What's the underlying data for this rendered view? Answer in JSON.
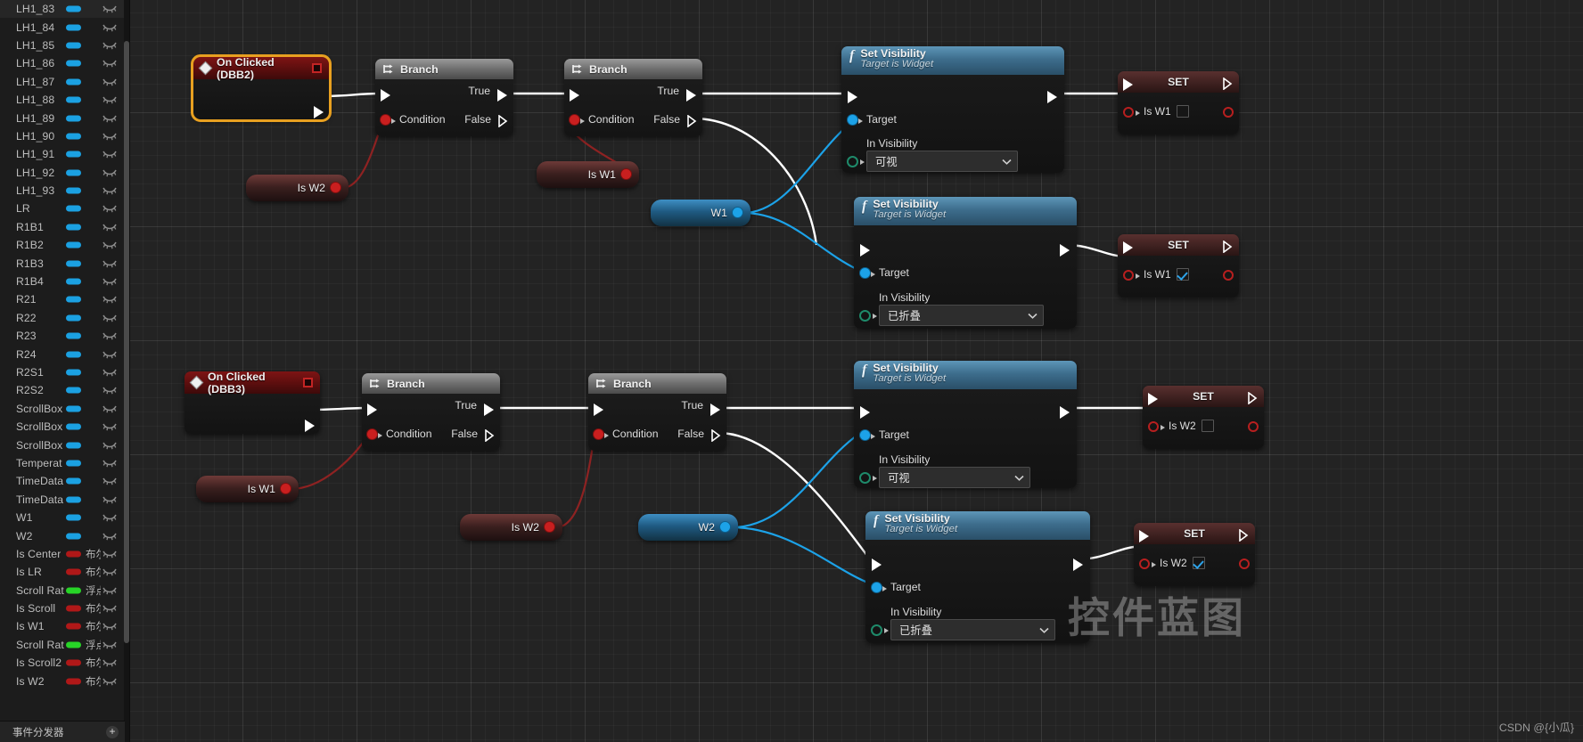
{
  "sidebar": {
    "variables": [
      {
        "name": "LH1_83",
        "pill": "#1ba1e2",
        "type": "",
        "eye": "eye-closed-icon"
      },
      {
        "name": "LH1_84",
        "pill": "#1ba1e2",
        "type": "",
        "eye": "eye-closed-icon"
      },
      {
        "name": "LH1_85",
        "pill": "#1ba1e2",
        "type": "",
        "eye": "eye-closed-icon"
      },
      {
        "name": "LH1_86",
        "pill": "#1ba1e2",
        "type": "",
        "eye": "eye-closed-icon"
      },
      {
        "name": "LH1_87",
        "pill": "#1ba1e2",
        "type": "",
        "eye": "eye-closed-icon"
      },
      {
        "name": "LH1_88",
        "pill": "#1ba1e2",
        "type": "",
        "eye": "eye-closed-icon"
      },
      {
        "name": "LH1_89",
        "pill": "#1ba1e2",
        "type": "",
        "eye": "eye-closed-icon"
      },
      {
        "name": "LH1_90",
        "pill": "#1ba1e2",
        "type": "",
        "eye": "eye-closed-icon"
      },
      {
        "name": "LH1_91",
        "pill": "#1ba1e2",
        "type": "",
        "eye": "eye-closed-icon"
      },
      {
        "name": "LH1_92",
        "pill": "#1ba1e2",
        "type": "",
        "eye": "eye-closed-icon"
      },
      {
        "name": "LH1_93",
        "pill": "#1ba1e2",
        "type": "",
        "eye": "eye-closed-icon"
      },
      {
        "name": "LR",
        "pill": "#1ba1e2",
        "type": "",
        "eye": "eye-closed-icon"
      },
      {
        "name": "R1B1",
        "pill": "#1ba1e2",
        "type": "",
        "eye": "eye-closed-icon"
      },
      {
        "name": "R1B2",
        "pill": "#1ba1e2",
        "type": "",
        "eye": "eye-closed-icon"
      },
      {
        "name": "R1B3",
        "pill": "#1ba1e2",
        "type": "",
        "eye": "eye-closed-icon"
      },
      {
        "name": "R1B4",
        "pill": "#1ba1e2",
        "type": "",
        "eye": "eye-closed-icon"
      },
      {
        "name": "R21",
        "pill": "#1ba1e2",
        "type": "",
        "eye": "eye-closed-icon"
      },
      {
        "name": "R22",
        "pill": "#1ba1e2",
        "type": "",
        "eye": "eye-closed-icon"
      },
      {
        "name": "R23",
        "pill": "#1ba1e2",
        "type": "",
        "eye": "eye-closed-icon"
      },
      {
        "name": "R24",
        "pill": "#1ba1e2",
        "type": "",
        "eye": "eye-closed-icon"
      },
      {
        "name": "R2S1",
        "pill": "#1ba1e2",
        "type": "",
        "eye": "eye-closed-icon"
      },
      {
        "name": "R2S2",
        "pill": "#1ba1e2",
        "type": "",
        "eye": "eye-closed-icon"
      },
      {
        "name": "ScrollBox",
        "pill": "#1ba1e2",
        "type": "",
        "eye": "eye-closed-icon"
      },
      {
        "name": "ScrollBox",
        "pill": "#1ba1e2",
        "type": "",
        "eye": "eye-closed-icon"
      },
      {
        "name": "ScrollBox",
        "pill": "#1ba1e2",
        "type": "",
        "eye": "eye-closed-icon"
      },
      {
        "name": "Temperat",
        "pill": "#1ba1e2",
        "type": "",
        "eye": "eye-closed-icon"
      },
      {
        "name": "TimeData",
        "pill": "#1ba1e2",
        "type": "",
        "eye": "eye-closed-icon"
      },
      {
        "name": "TimeData",
        "pill": "#1ba1e2",
        "type": "",
        "eye": "eye-closed-icon"
      },
      {
        "name": "W1",
        "pill": "#1ba1e2",
        "type": "",
        "eye": "eye-closed-icon"
      },
      {
        "name": "W2",
        "pill": "#1ba1e2",
        "type": "",
        "eye": "eye-closed-icon"
      },
      {
        "name": "Is Center",
        "pill": "#b01818",
        "type": "布尔",
        "eye": "eye-closed-icon"
      },
      {
        "name": "Is LR",
        "pill": "#b01818",
        "type": "布尔",
        "eye": "eye-closed-icon"
      },
      {
        "name": "Scroll Rat",
        "pill": "#27d427",
        "type": "浮点",
        "eye": "eye-closed-icon"
      },
      {
        "name": "Is Scroll",
        "pill": "#b01818",
        "type": "布尔",
        "eye": "eye-closed-icon"
      },
      {
        "name": "Is W1",
        "pill": "#b01818",
        "type": "布尔",
        "eye": "eye-closed-icon"
      },
      {
        "name": "Scroll Rat",
        "pill": "#27d427",
        "type": "浮点",
        "eye": "eye-closed-icon"
      },
      {
        "name": "Is Scroll2",
        "pill": "#b01818",
        "type": "布尔",
        "eye": "eye-closed-icon"
      },
      {
        "name": "Is W2",
        "pill": "#b01818",
        "type": "布尔",
        "eye": "eye-closed-icon"
      }
    ],
    "dispatcher_label": "事件分发器",
    "add_button": "+"
  },
  "graph": {
    "events": [
      {
        "title": "On Clicked (DBB2)",
        "selected": true
      },
      {
        "title": "On Clicked (DBB3)",
        "selected": false
      }
    ],
    "branches": [
      {
        "title": "Branch",
        "true_label": "True",
        "false_label": "False",
        "condition_label": "Condition"
      },
      {
        "title": "Branch",
        "true_label": "True",
        "false_label": "False",
        "condition_label": "Condition"
      },
      {
        "title": "Branch",
        "true_label": "True",
        "false_label": "False",
        "condition_label": "Condition"
      },
      {
        "title": "Branch",
        "true_label": "True",
        "false_label": "False",
        "condition_label": "Condition"
      }
    ],
    "set_visibility_nodes": [
      {
        "title": "Set Visibility",
        "subtitle": "Target is Widget",
        "target_label": "Target",
        "in_visibility_label": "In Visibility",
        "visibility_value": "可视"
      },
      {
        "title": "Set Visibility",
        "subtitle": "Target is Widget",
        "target_label": "Target",
        "in_visibility_label": "In Visibility",
        "visibility_value": "已折叠"
      },
      {
        "title": "Set Visibility",
        "subtitle": "Target is Widget",
        "target_label": "Target",
        "in_visibility_label": "In Visibility",
        "visibility_value": "可视"
      },
      {
        "title": "Set Visibility",
        "subtitle": "Target is Widget",
        "target_label": "Target",
        "in_visibility_label": "In Visibility",
        "visibility_value": "已折叠"
      }
    ],
    "set_nodes": [
      {
        "title": "SET",
        "var_label": "Is W1",
        "checked": false
      },
      {
        "title": "SET",
        "var_label": "Is W1",
        "checked": true
      },
      {
        "title": "SET",
        "var_label": "Is W2",
        "checked": false
      },
      {
        "title": "SET",
        "var_label": "Is W2",
        "checked": true
      }
    ],
    "getters": [
      {
        "label": "Is W2",
        "kind": "bool"
      },
      {
        "label": "Is W1",
        "kind": "bool"
      },
      {
        "label": "W1",
        "kind": "object"
      },
      {
        "label": "Is W1",
        "kind": "bool"
      },
      {
        "label": "Is W2",
        "kind": "bool"
      },
      {
        "label": "W2",
        "kind": "object"
      }
    ]
  },
  "watermarks": {
    "main": "控件蓝图",
    "credit": "CSDN @{小瓜}"
  },
  "colors": {
    "exec_wire": "#ffffff",
    "bool_wire": "#8a1f1f",
    "object_wire": "#1ca2e8",
    "event_header": "#6b1111",
    "function_header": "#3d6d8c",
    "set_header": "#3e2120",
    "selection": "#e8a020"
  }
}
